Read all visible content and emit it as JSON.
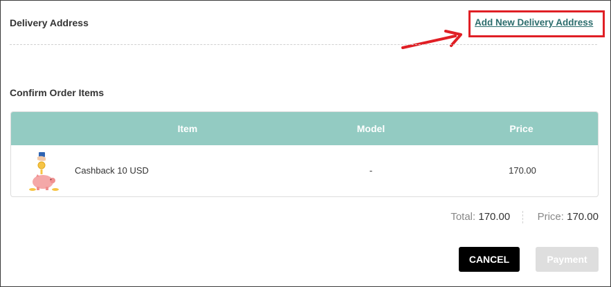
{
  "delivery": {
    "title": "Delivery Address",
    "add_link": "Add New Delivery Address"
  },
  "confirm": {
    "title": "Confirm Order Items"
  },
  "table": {
    "headers": {
      "item": "Item",
      "model": "Model",
      "price": "Price"
    },
    "rows": [
      {
        "item": "Cashback 10 USD",
        "model": "-",
        "price": "170.00",
        "thumbnail_icon": "piggy-bank-icon"
      }
    ]
  },
  "summary": {
    "total_label": "Total:",
    "total_value": "170.00",
    "price_label": "Price:",
    "price_value": "170.00"
  },
  "actions": {
    "cancel_label": "CANCEL",
    "payment_label": "Payment"
  },
  "colors": {
    "table_header": "#93cbc2",
    "link": "#2b6c6c",
    "highlight": "#e01f25",
    "cancel_bg": "#000000",
    "payment_disabled_bg": "#dedede"
  }
}
